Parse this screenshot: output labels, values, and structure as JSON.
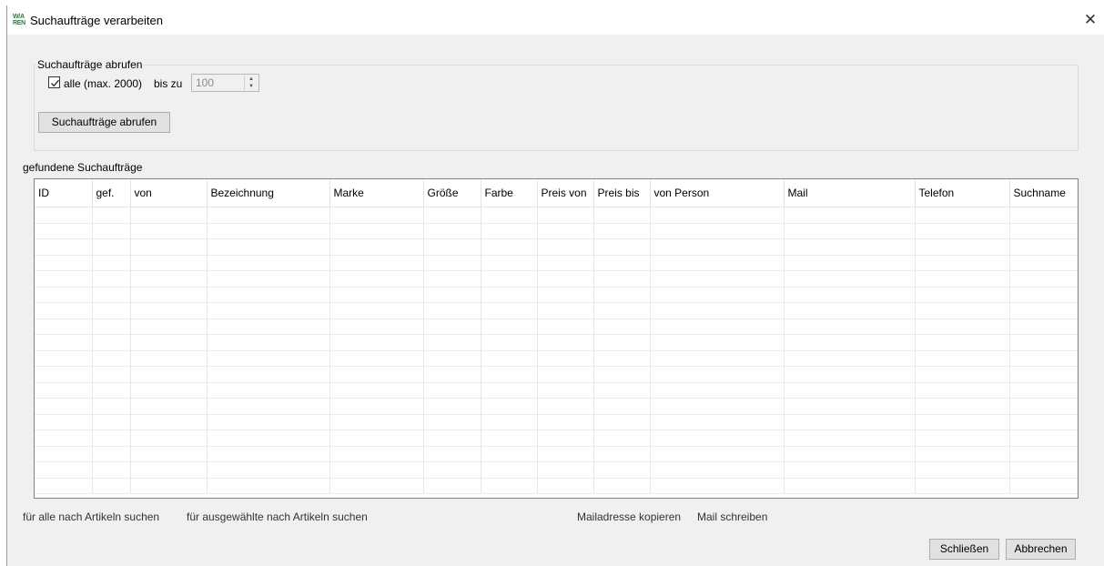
{
  "window": {
    "title": "Suchaufträge verarbeiten",
    "icon_text": "WARREN",
    "close_icon": "✕"
  },
  "fetch_group": {
    "legend": "Suchaufträge abrufen",
    "all_checkbox_checked": true,
    "all_label": "alle (max. 2000)",
    "up_to_label": "bis zu",
    "up_to_value": "100",
    "fetch_button": "Suchaufträge abrufen"
  },
  "results": {
    "label": "gefundene Suchaufträge",
    "columns": [
      "ID",
      "gef.",
      "von",
      "Bezeichnung",
      "Marke",
      "Größe",
      "Farbe",
      "Preis von",
      "Preis bis",
      "von Person",
      "Mail",
      "Telefon",
      "Suchname"
    ],
    "rows": []
  },
  "actions": {
    "search_all": "für alle nach Artikeln suchen",
    "search_selected": "für ausgewählte nach Artikeln suchen",
    "copy_mail": "Mailadresse kopieren",
    "write_mail": "Mail schreiben"
  },
  "footer": {
    "close_button": "Schließen",
    "cancel_button": "Abbrechen"
  }
}
